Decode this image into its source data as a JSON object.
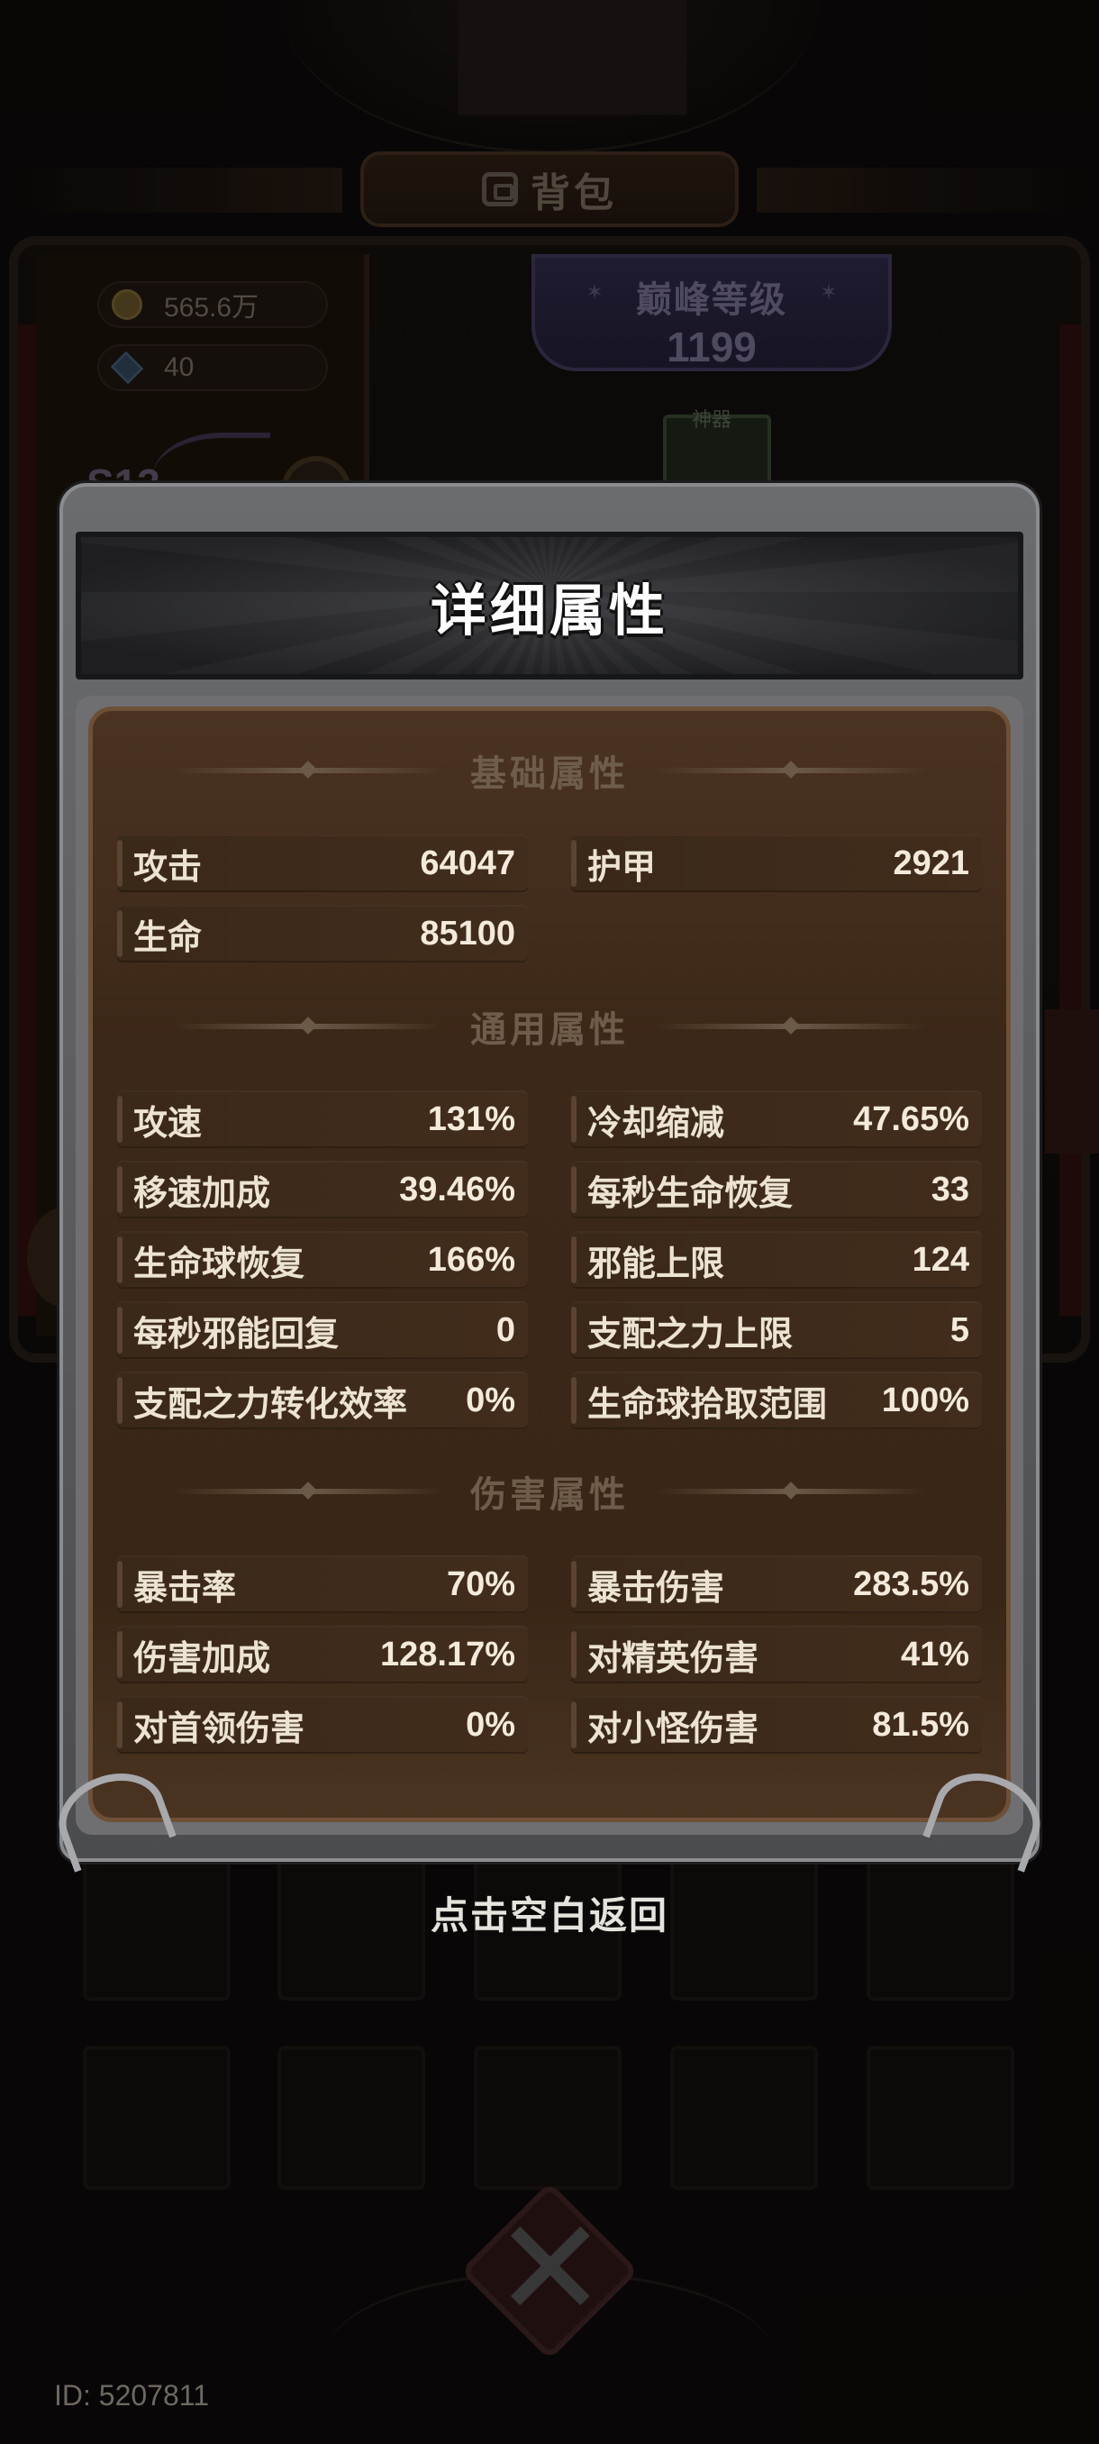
{
  "background": {
    "title": "背包",
    "gold": "565.6万",
    "gems": "40",
    "peak_label": "巅峰等级",
    "peak_level": "1199",
    "season": "S13",
    "card_tag": "神器"
  },
  "modal": {
    "title": "详细属性",
    "sections": {
      "basic": {
        "label": "基础属性",
        "stats": [
          {
            "label": "攻击",
            "value": "64047"
          },
          {
            "label": "护甲",
            "value": "2921"
          },
          {
            "label": "生命",
            "value": "85100"
          }
        ]
      },
      "general": {
        "label": "通用属性",
        "stats": [
          {
            "label": "攻速",
            "value": "131%"
          },
          {
            "label": "冷却缩减",
            "value": "47.65%"
          },
          {
            "label": "移速加成",
            "value": "39.46%"
          },
          {
            "label": "每秒生命恢复",
            "value": "33"
          },
          {
            "label": "生命球恢复",
            "value": "166%"
          },
          {
            "label": "邪能上限",
            "value": "124"
          },
          {
            "label": "每秒邪能回复",
            "value": "0"
          },
          {
            "label": "支配之力上限",
            "value": "5"
          },
          {
            "label": "支配之力转化效率",
            "value": "0%"
          },
          {
            "label": "生命球拾取范围",
            "value": "100%"
          }
        ]
      },
      "damage": {
        "label": "伤害属性",
        "stats": [
          {
            "label": "暴击率",
            "value": "70%"
          },
          {
            "label": "暴击伤害",
            "value": "283.5%"
          },
          {
            "label": "伤害加成",
            "value": "128.17%"
          },
          {
            "label": "对精英伤害",
            "value": "41%"
          },
          {
            "label": "对首领伤害",
            "value": "0%"
          },
          {
            "label": "对小怪伤害",
            "value": "81.5%"
          }
        ]
      }
    },
    "close_hint": "点击空白返回"
  },
  "footer": {
    "user_id": "ID: 5207811"
  }
}
